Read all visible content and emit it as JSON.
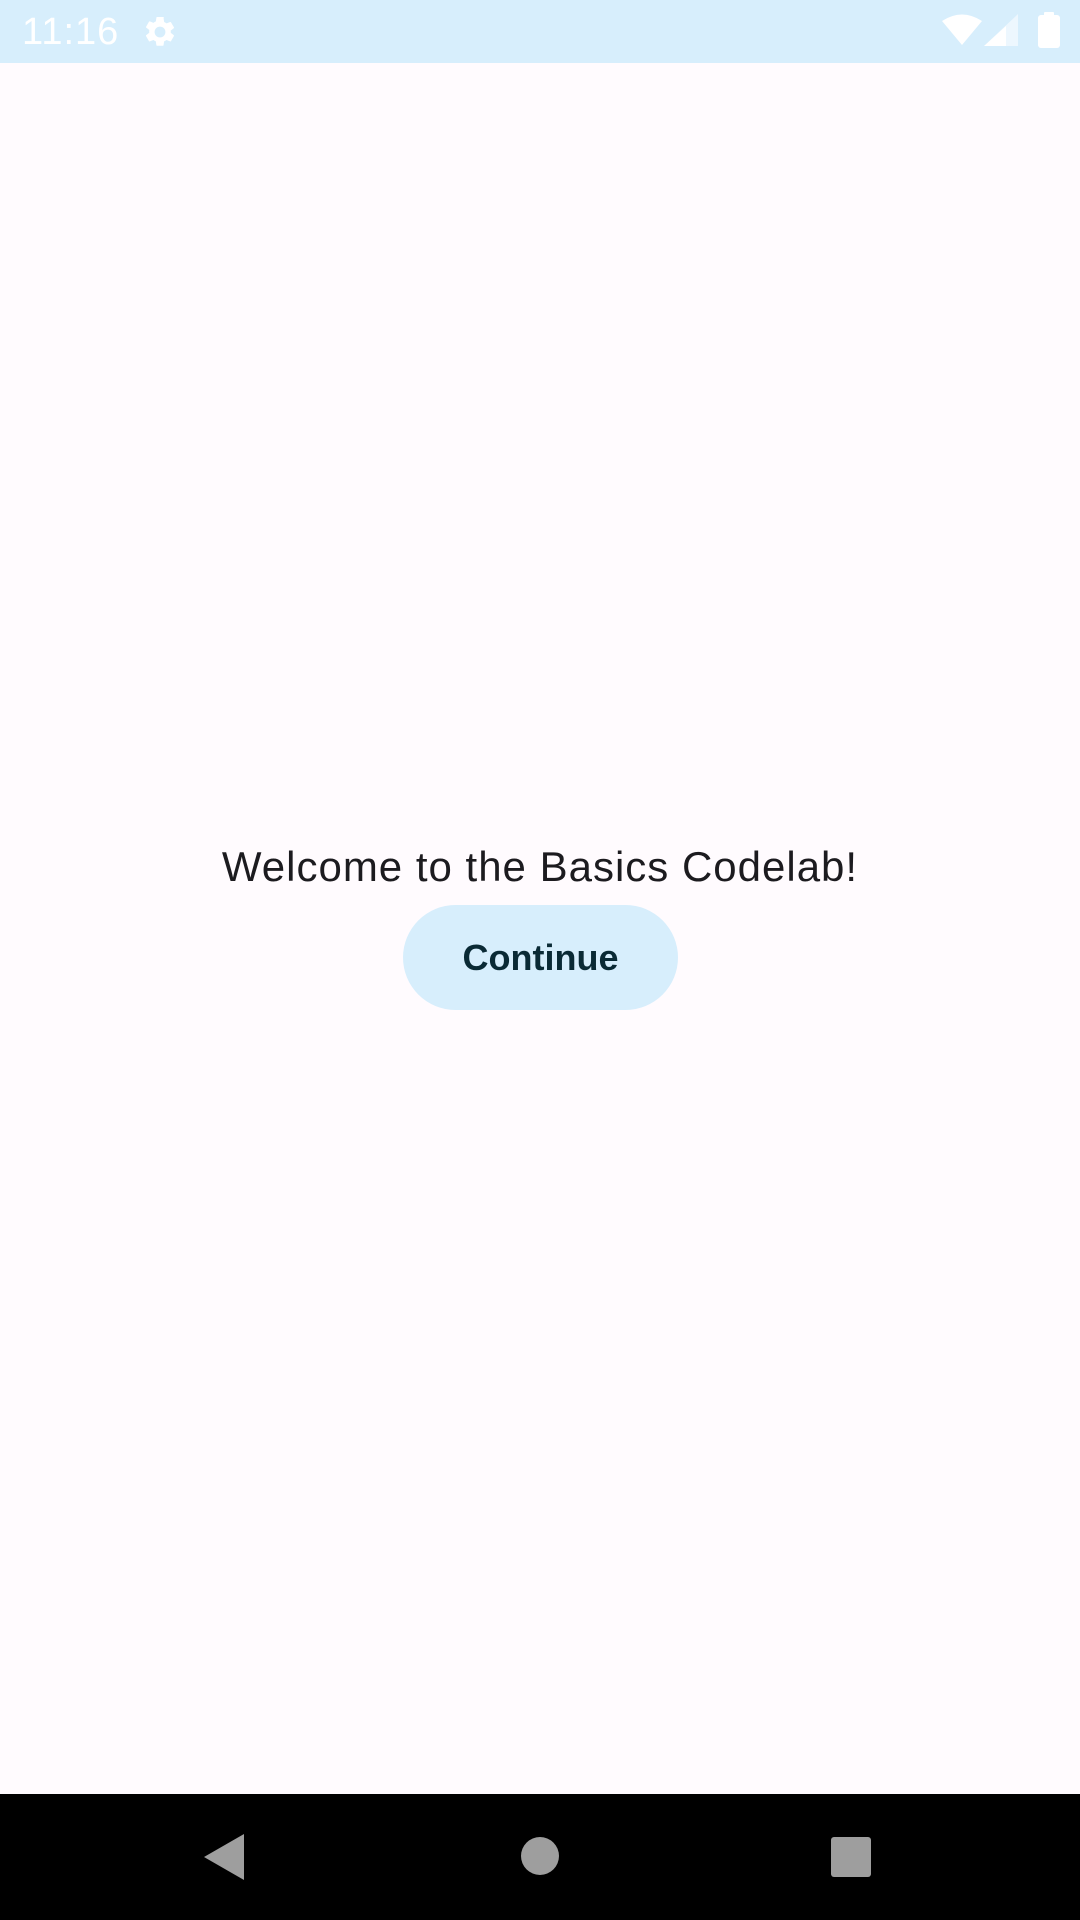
{
  "status_bar": {
    "time": "11:16",
    "icons": [
      "gear-icon",
      "wifi-icon",
      "signal-icon",
      "battery-icon"
    ]
  },
  "main": {
    "welcome_text": "Welcome to the Basics Codelab!",
    "continue_label": "Continue"
  },
  "nav_bar": {
    "icons": [
      "back-icon",
      "home-icon",
      "recents-icon"
    ]
  },
  "colors": {
    "background": "#FFFBFE",
    "status_bar": "#D7EEFC",
    "button_fill": "#D7EEFC",
    "button_text": "#0A2A35",
    "body_text": "#1C1B1F",
    "nav_bar": "#000000"
  }
}
